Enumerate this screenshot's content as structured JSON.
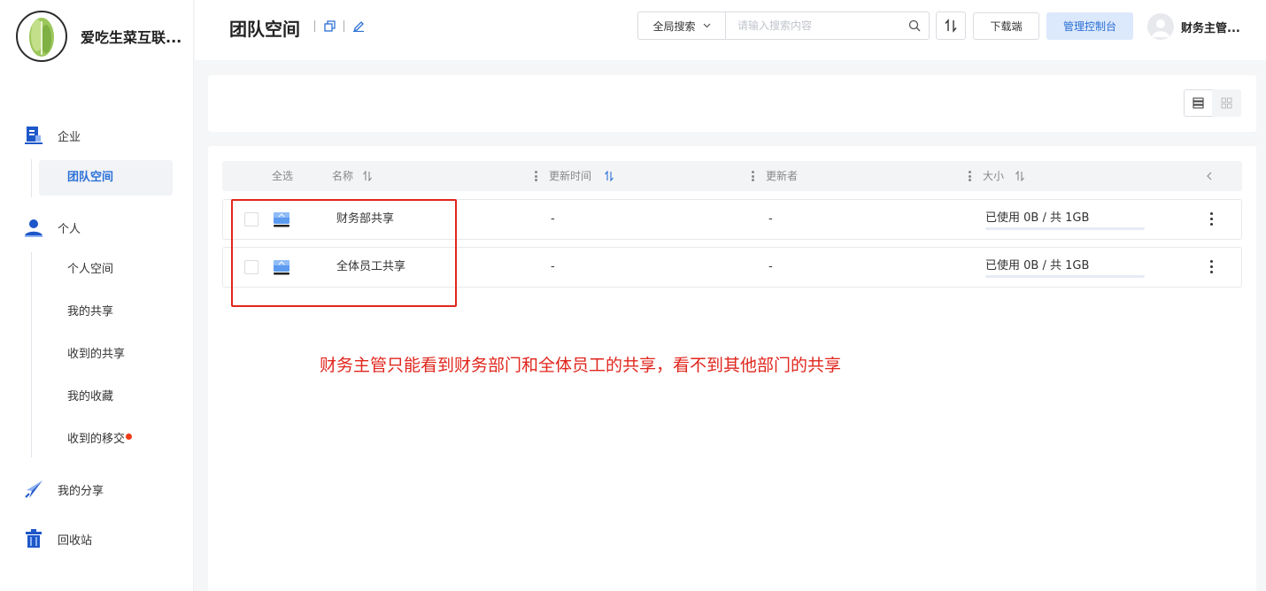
{
  "brand": {
    "name": "爱吃生菜互联..."
  },
  "sidebar": {
    "enterprise": {
      "label": "企业",
      "items": [
        {
          "label": "团队空间",
          "active": true
        }
      ]
    },
    "personal": {
      "label": "个人",
      "items": [
        {
          "label": "个人空间"
        },
        {
          "label": "我的共享"
        },
        {
          "label": "收到的共享"
        },
        {
          "label": "我的收藏"
        },
        {
          "label": "收到的移交",
          "badge_color": "#f03a17"
        }
      ]
    },
    "my_share": {
      "label": "我的分享"
    },
    "recycle": {
      "label": "回收站"
    }
  },
  "header": {
    "title": "团队空间",
    "search": {
      "scope": "全局搜索",
      "placeholder": "请输入搜索内容"
    },
    "download_label": "下载端",
    "admin_label": "管理控制台",
    "user_name": "财务主管..."
  },
  "table": {
    "columns": {
      "select_all": "全选",
      "name": "名称",
      "updated": "更新时间",
      "updater": "更新者",
      "size": "大小"
    },
    "rows": [
      {
        "name": "财务部共享",
        "updated": "-",
        "updater": "-",
        "usage": "已使用 0B / 共 1GB",
        "usage_fraction": 0.0
      },
      {
        "name": "全体员工共享",
        "updated": "-",
        "updater": "-",
        "usage": "已使用 0B / 共 1GB",
        "usage_fraction": 0.0
      }
    ]
  },
  "annotation": {
    "text": "财务主管只能看到财务部门和全体员工的共享，看不到其他部门的共享",
    "color": "#e0261d"
  },
  "colors": {
    "accent": "#2a6fd6",
    "accent_bg": "#dce8fb",
    "alert": "#e0261d"
  }
}
